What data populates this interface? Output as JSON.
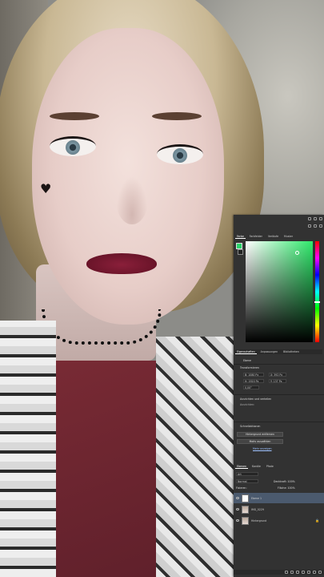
{
  "color_panel": {
    "tabs": [
      "Farbe",
      "Farbfelder",
      "Verläufe",
      "Muster"
    ],
    "foreground": "#2bd36a",
    "background": "#222222"
  },
  "properties_panel": {
    "tabs": [
      "Eigenschaften",
      "Anpassungen",
      "Bibliotheken"
    ],
    "layer_type": "Ebene",
    "transform": {
      "title": "Transformieren",
      "b": "B: 1080 Px",
      "x": "X: 392 Px",
      "h": "H: 1920 Px",
      "y": "Y: 137 Px",
      "angle": "0,00°"
    },
    "align": {
      "title": "Ausrichten und verteilen",
      "label": "Ausrichten:"
    },
    "quick": {
      "title": "Schnellaktionen",
      "btn1": "Hintergrund entfernen",
      "btn2": "Motiv auswählen",
      "more": "Mehr anzeigen"
    }
  },
  "layers_panel": {
    "tabs": [
      "Ebenen",
      "Kanäle",
      "Pfade"
    ],
    "search": "Art",
    "blend_mode": "Normal",
    "opacity": "Deckkraft: 100%",
    "fix": "Fixieren:",
    "fill": "Fläche: 100%",
    "layers": [
      {
        "name": "Ebene 1",
        "selected": true
      },
      {
        "name": "IMG_0229",
        "selected": false
      },
      {
        "name": "Hintergrund",
        "selected": false
      }
    ]
  }
}
